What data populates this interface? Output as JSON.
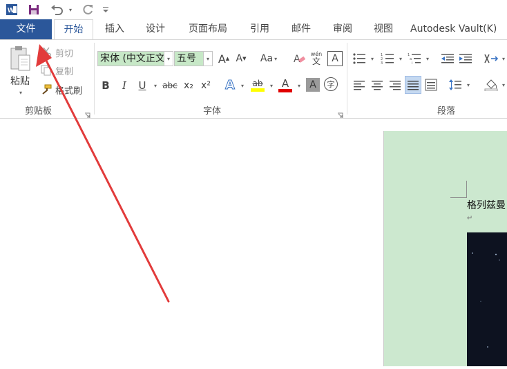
{
  "quick_access": {
    "icons": [
      "word-logo-icon",
      "save-icon",
      "undo-icon",
      "redo-icon",
      "customize-qat-icon"
    ]
  },
  "tabs": [
    {
      "label": "文件"
    },
    {
      "label": "开始"
    },
    {
      "label": "插入"
    },
    {
      "label": "设计"
    },
    {
      "label": "页面布局"
    },
    {
      "label": "引用"
    },
    {
      "label": "邮件"
    },
    {
      "label": "审阅"
    },
    {
      "label": "视图"
    },
    {
      "label": "Autodesk Vault(K)"
    }
  ],
  "clipboard": {
    "paste_label": "粘贴",
    "cut_label": "剪切",
    "copy_label": "复制",
    "format_painter_label": "格式刷",
    "group_label": "剪贴板"
  },
  "font": {
    "font_name": "宋体 (中文正文)",
    "font_size": "五号",
    "grow_font": "A",
    "shrink_font": "A",
    "change_case": "Aa",
    "clear_format": "A",
    "phonetic": "wén",
    "phonetic_char": "文",
    "char_border": "A",
    "bold": "B",
    "italic": "I",
    "underline": "U",
    "strikethrough": "abc",
    "subscript": "x₂",
    "superscript": "x²",
    "text_effect": "A",
    "highlight": "ab",
    "font_color": "A",
    "char_shading": "A",
    "enclose_char": "字",
    "group_label": "字体"
  },
  "paragraph": {
    "group_label": "段落"
  },
  "document": {
    "text": "格列兹曼"
  },
  "colors": {
    "accent": "#2b579a",
    "page_background": "#cce8cf",
    "annotation_arrow": "#e23b3b",
    "highlight_yellow": "#ffff00",
    "font_red": "#e00000"
  }
}
